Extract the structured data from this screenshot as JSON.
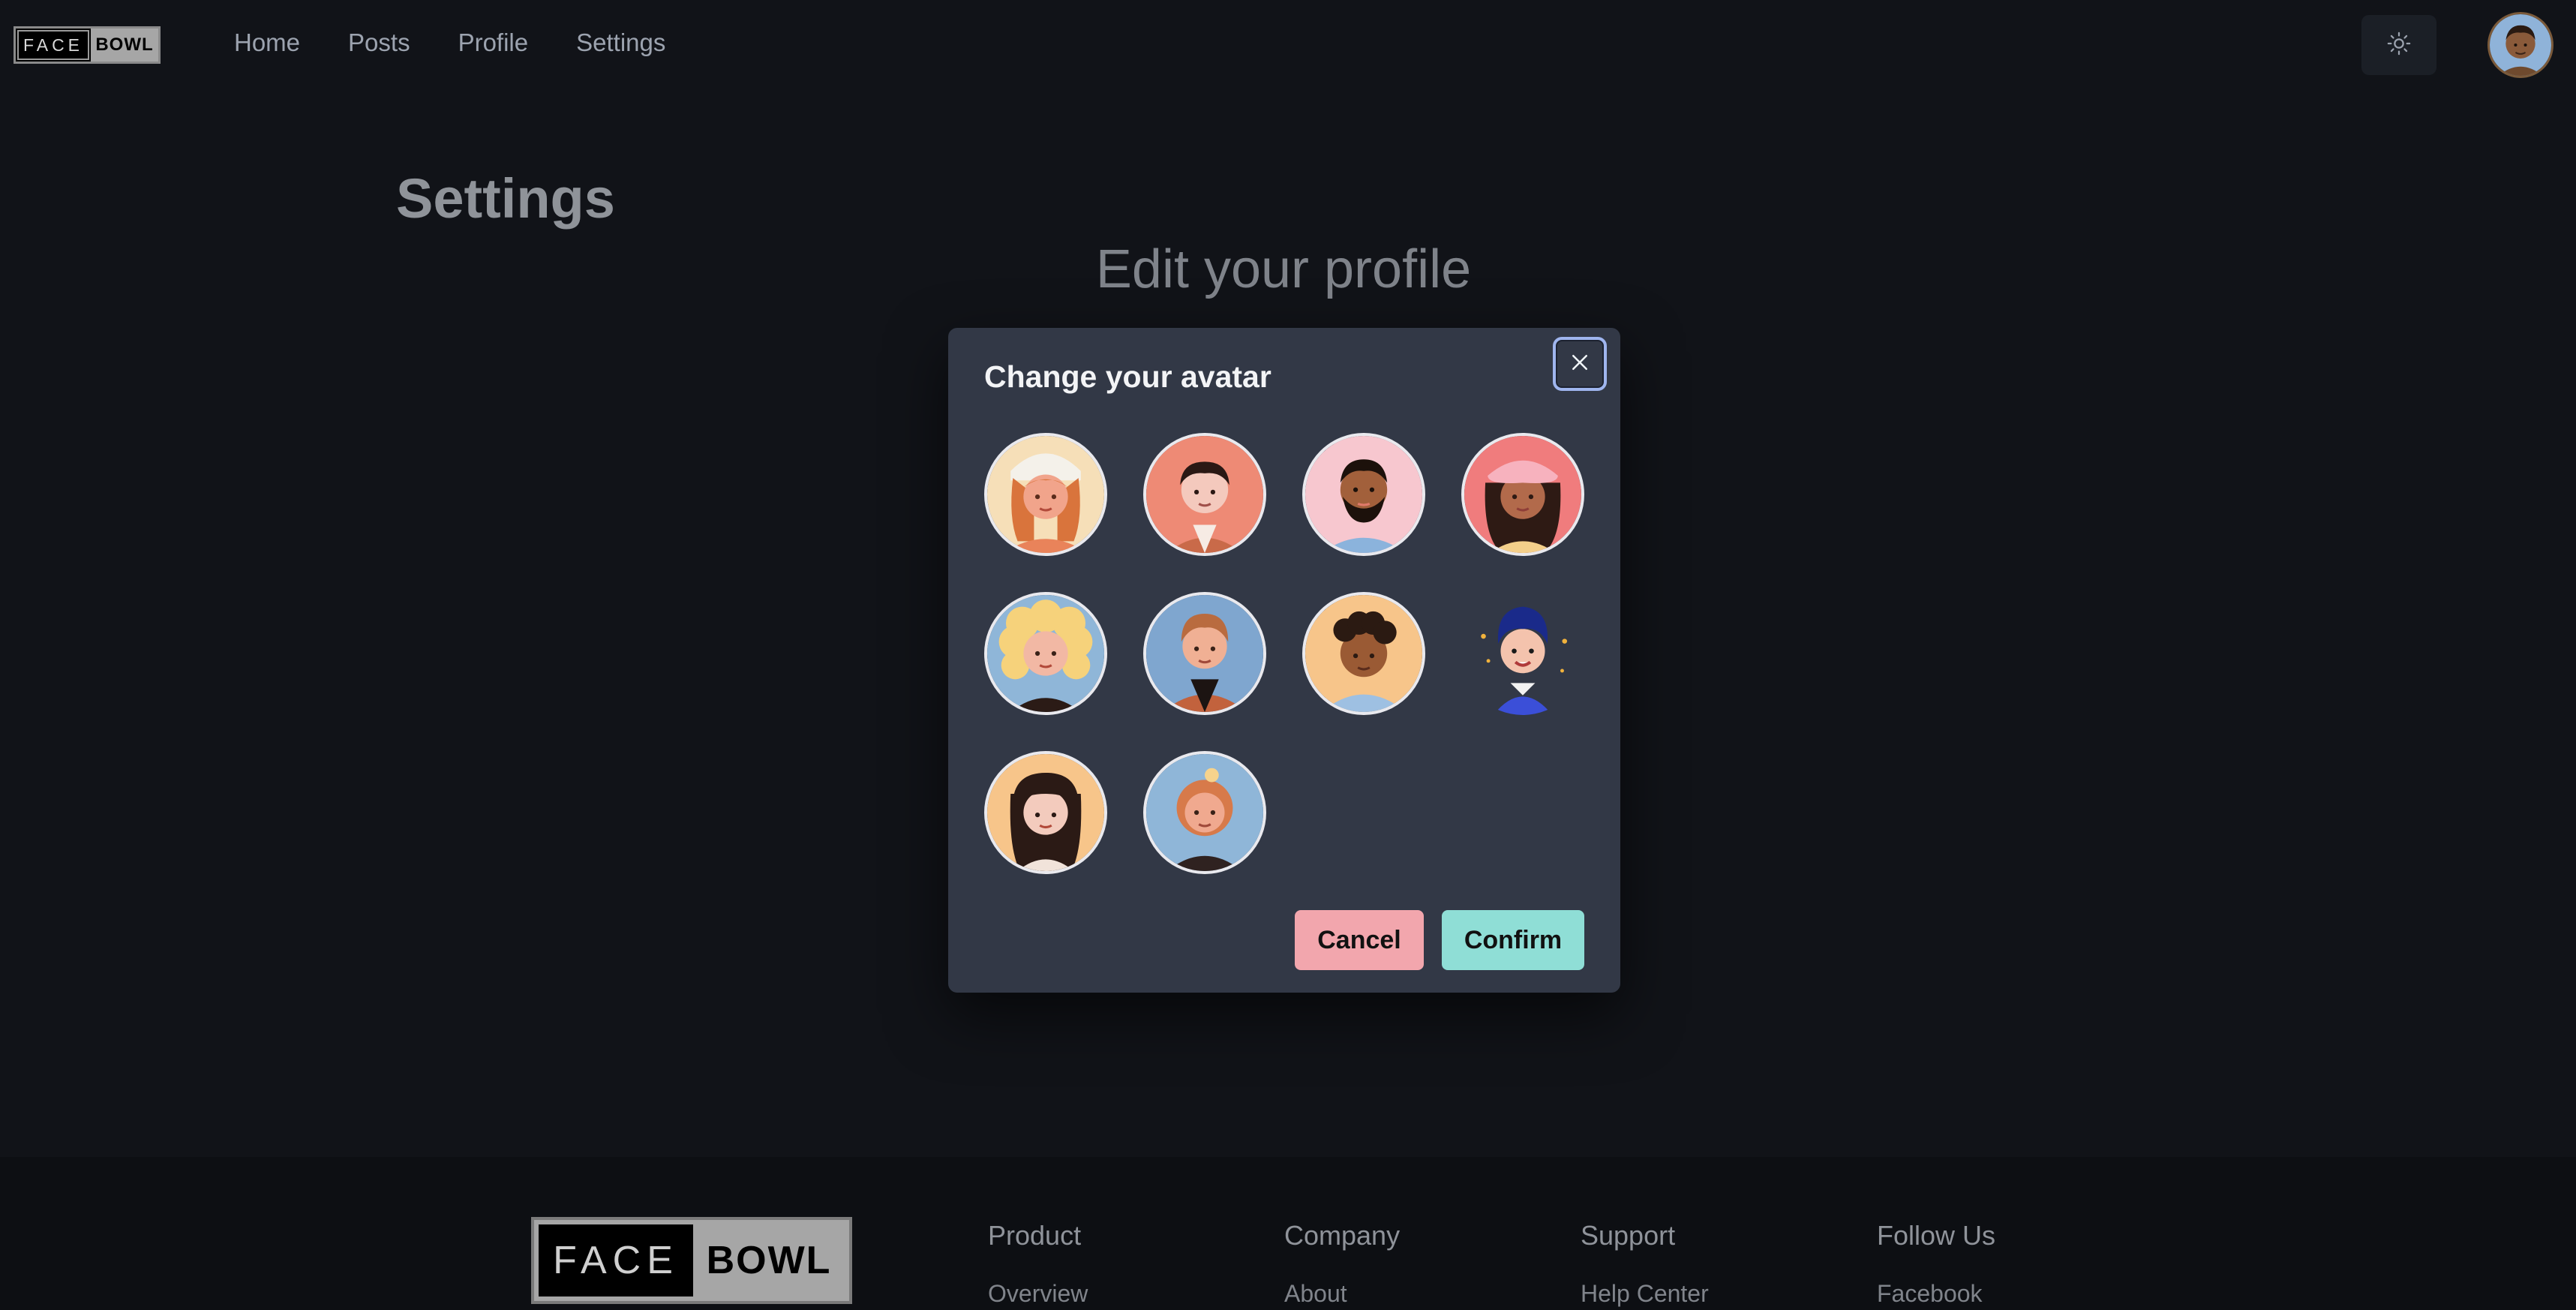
{
  "header": {
    "logo": {
      "face": "FACE",
      "bowl": "BOWL"
    },
    "nav": [
      "Home",
      "Posts",
      "Profile",
      "Settings"
    ],
    "theme_icon": "sun-icon"
  },
  "main": {
    "title": "Settings",
    "subtitle": "Edit your profile"
  },
  "modal": {
    "title": "Change your avatar",
    "close_icon": "close-icon",
    "cancel_label": "Cancel",
    "confirm_label": "Confirm",
    "avatar_count": 10
  },
  "footer": {
    "logo": {
      "face": "FACE",
      "bowl": "BOWL"
    },
    "columns": [
      {
        "heading": "Product",
        "link": "Overview"
      },
      {
        "heading": "Company",
        "link": "About"
      },
      {
        "heading": "Support",
        "link": "Help Center"
      },
      {
        "heading": "Follow Us",
        "link": "Facebook"
      }
    ]
  },
  "colors": {
    "background": "#111318",
    "modal": "#323846",
    "cancel": "#f2a6ad",
    "confirm": "#8fded6"
  }
}
